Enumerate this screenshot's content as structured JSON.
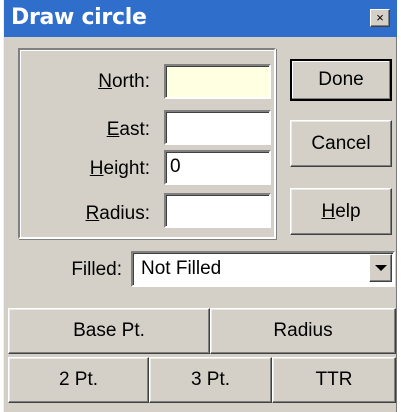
{
  "window": {
    "title": "Draw circle",
    "close_glyph": "×"
  },
  "fields": {
    "north": {
      "label_mnemonic": "N",
      "label_rest": "orth:",
      "value": ""
    },
    "east": {
      "label_mnemonic": "E",
      "label_rest": "ast:",
      "value": ""
    },
    "height": {
      "label_mnemonic": "H",
      "label_rest": "eight:",
      "value": "0"
    },
    "radius": {
      "label_mnemonic": "R",
      "label_rest": "adius:",
      "value": ""
    }
  },
  "buttons": {
    "done": "Done",
    "cancel": "Cancel",
    "help_mnemonic": "H",
    "help_rest": "elp",
    "base_pt": "Base Pt.",
    "radius": "Radius",
    "two_pt": "2 Pt.",
    "three_pt": "3 Pt.",
    "ttr": "TTR"
  },
  "filled": {
    "label": "Filled:",
    "selected": "Not Filled"
  },
  "colors": {
    "titlebar": "#2f6ecb",
    "face": "#d4d0c8",
    "highlight_field": "#ffffe1"
  }
}
